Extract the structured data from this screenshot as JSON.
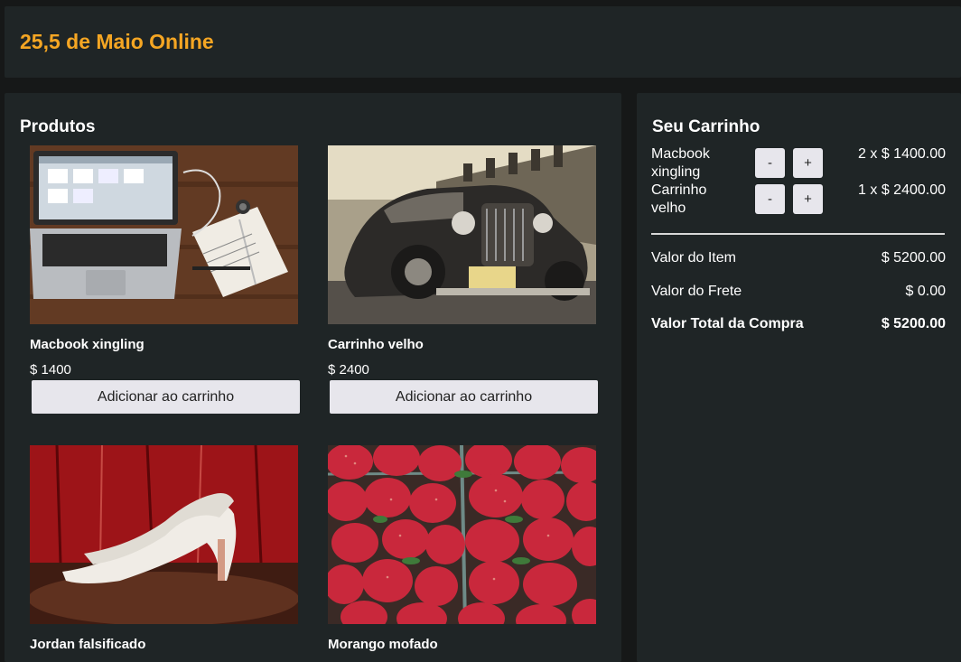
{
  "header": {
    "brand": "25,5 de Maio Online"
  },
  "products": {
    "title": "Produtos",
    "items": [
      {
        "name": "Macbook xingling",
        "price": "$ 1400",
        "button": "Adicionar ao carrinho",
        "image": "laptop-photo"
      },
      {
        "name": "Carrinho velho",
        "price": "$ 2400",
        "button": "Adicionar ao carrinho",
        "image": "vintage-car-photo"
      },
      {
        "name": "Jordan falsificado",
        "price": "",
        "button": "",
        "image": "white-heels-photo"
      },
      {
        "name": "Morango mofado",
        "price": "",
        "button": "",
        "image": "strawberries-photo"
      }
    ]
  },
  "cart": {
    "title": "Seu Carrinho",
    "items": [
      {
        "name": "Macbook xingling",
        "qty": "2 x $ 1400.00",
        "minus": "-",
        "plus": "+"
      },
      {
        "name": "Carrinho velho",
        "qty": "1 x $ 2400.00",
        "minus": "-",
        "plus": "+"
      }
    ],
    "item_value_label": "Valor do Item",
    "item_value": "$ 5200.00",
    "shipping_label": "Valor do Frete",
    "shipping_value": "$ 0.00",
    "total_label": "Valor Total da Compra",
    "total_value": "$ 5200.00"
  },
  "colors": {
    "accent": "#f5a623",
    "panel": "#1f2526",
    "background": "#161818",
    "button": "#e7e6ec"
  }
}
